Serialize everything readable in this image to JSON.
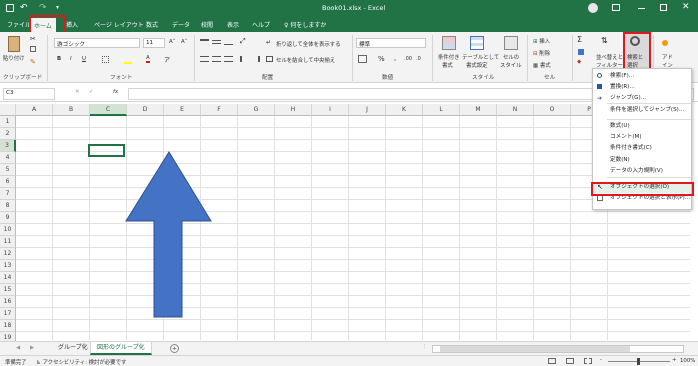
{
  "title_bar": {
    "file_name": "Book01.xlsx",
    "separator": "-",
    "app": "Excel",
    "search_hint": "何をしますか"
  },
  "tabs": [
    {
      "label": "ファイル",
      "active": false
    },
    {
      "label": "ホーム",
      "active": true
    },
    {
      "label": "挿入",
      "active": false
    },
    {
      "label": "ページ レイアウト",
      "active": false
    },
    {
      "label": "数式",
      "active": false
    },
    {
      "label": "データ",
      "active": false
    },
    {
      "label": "校閲",
      "active": false
    },
    {
      "label": "表示",
      "active": false
    },
    {
      "label": "ヘルプ",
      "active": false
    }
  ],
  "ribbon": {
    "clipboard": {
      "paste": "貼り付け",
      "group": "クリップボード"
    },
    "font": {
      "font_name": "游ゴシック",
      "font_size": "11",
      "group": "フォント"
    },
    "alignment": {
      "wrap": "折り返して全体を表示する",
      "merge": "セルを結合して中央揃え",
      "group": "配置"
    },
    "number": {
      "format": "標準",
      "group": "数値"
    },
    "styles": {
      "conditional": [
        "条件付き",
        "書式"
      ],
      "table": [
        "テーブルとして",
        "書式設定"
      ],
      "cell": [
        "セルの",
        "スタイル"
      ],
      "group": "スタイル"
    },
    "cells": {
      "insert": "挿入",
      "delete": "削除",
      "format": "書式",
      "group": "セル"
    },
    "editing": {
      "sort": [
        "並べ替えと",
        "フィルター"
      ],
      "find": [
        "検索と",
        "選択"
      ]
    },
    "addin": [
      "アド",
      "イン"
    ]
  },
  "name_box": "C3",
  "formula_bar": {
    "fx": "fx",
    "value": ""
  },
  "columns": [
    "A",
    "B",
    "C",
    "D",
    "E",
    "F",
    "G",
    "H",
    "I",
    "J",
    "K",
    "L",
    "M",
    "N",
    "O",
    "P"
  ],
  "rows": [
    "1",
    "2",
    "3",
    "4",
    "5",
    "6",
    "7",
    "8",
    "9",
    "10",
    "11",
    "12",
    "13",
    "14",
    "15",
    "16",
    "17",
    "18",
    "19"
  ],
  "active_cell": "C3",
  "shape": {
    "type": "up-arrow",
    "fill": "#4472c4",
    "outline": "#2f528f"
  },
  "find_menu": {
    "items": [
      {
        "label": "検索(F)...",
        "icon": "search-icon"
      },
      {
        "label": "置換(R)...",
        "icon": "replace-icon"
      },
      {
        "label": "ジャンプ(G)...",
        "icon": "goto-arrow-icon"
      },
      {
        "label": "条件を選択してジャンプ(S)...",
        "icon": ""
      },
      {
        "label": "数式(U)",
        "icon": ""
      },
      {
        "label": "コメント(M)",
        "icon": ""
      },
      {
        "label": "条件付き書式(C)",
        "icon": ""
      },
      {
        "label": "定数(N)",
        "icon": ""
      },
      {
        "label": "データの入力規則(V)",
        "icon": ""
      },
      {
        "label": "オブジェクトの選択(O)",
        "icon": "pointer-icon",
        "highlighted": true
      },
      {
        "label": "オブジェクトの選択と表示(P)...",
        "icon": "selection-pane-icon"
      }
    ]
  },
  "sheets": [
    {
      "name": "グループ化",
      "active": false
    },
    {
      "name": "図形のグループ化",
      "active": true
    }
  ],
  "status": {
    "ready": "準備完了",
    "accessibility": "アクセシビリティ: 検討が必要です",
    "zoom": "100%",
    "zoom_minus": "-",
    "zoom_plus": "+"
  },
  "accent_color": "#217346",
  "highlight_color": "#e0181e"
}
